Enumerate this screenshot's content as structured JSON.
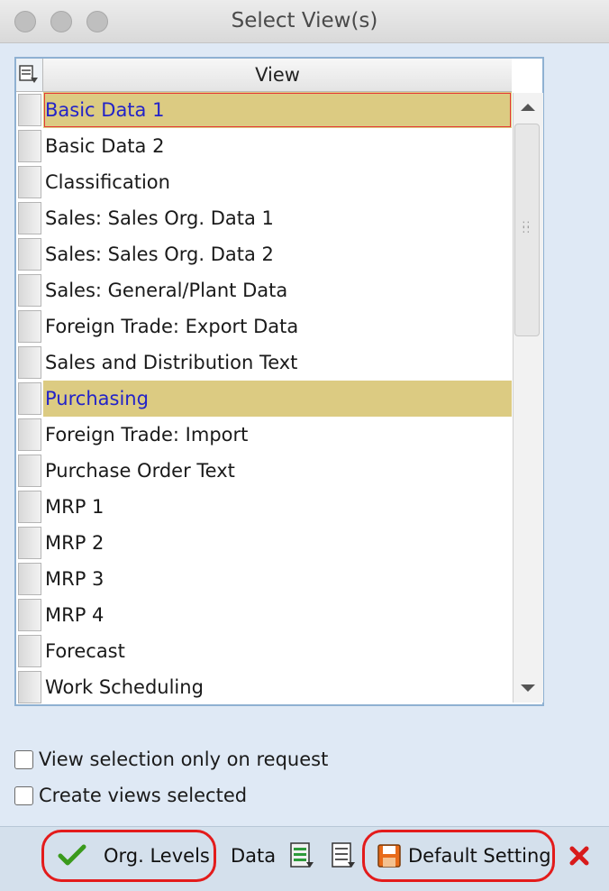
{
  "window": {
    "title": "Select View(s)"
  },
  "table": {
    "column_header": "View",
    "rows": [
      {
        "label": "Basic Data 1",
        "selected": true
      },
      {
        "label": "Basic Data 2",
        "selected": false
      },
      {
        "label": "Classification",
        "selected": false
      },
      {
        "label": "Sales: Sales Org. Data 1",
        "selected": false
      },
      {
        "label": "Sales: Sales Org. Data 2",
        "selected": false
      },
      {
        "label": "Sales: General/Plant Data",
        "selected": false
      },
      {
        "label": "Foreign Trade: Export Data",
        "selected": false
      },
      {
        "label": "Sales and Distribution Text",
        "selected": false
      },
      {
        "label": "Purchasing",
        "selected": true
      },
      {
        "label": "Foreign Trade: Import",
        "selected": false
      },
      {
        "label": "Purchase Order Text",
        "selected": false
      },
      {
        "label": "MRP 1",
        "selected": false
      },
      {
        "label": "MRP 2",
        "selected": false
      },
      {
        "label": "MRP 3",
        "selected": false
      },
      {
        "label": "MRP 4",
        "selected": false
      },
      {
        "label": "Forecast",
        "selected": false
      },
      {
        "label": "Work Scheduling",
        "selected": false
      }
    ]
  },
  "options": {
    "view_selection_label": "View selection only on request",
    "create_views_label": "Create views selected"
  },
  "toolbar": {
    "org_levels_label": "Org. Levels",
    "data_label": "Data",
    "default_setting_label": "Default Setting"
  },
  "colors": {
    "selected_row_bg": "#dccb82",
    "selected_row_text": "#2323c8",
    "annotation_ring": "#e31b1b"
  },
  "icons": [
    "table-settings-icon",
    "checkmark-icon",
    "select-all-icon",
    "deselect-all-icon",
    "save-default-icon",
    "close-x-icon",
    "scroll-up-icon",
    "scroll-down-icon"
  ]
}
